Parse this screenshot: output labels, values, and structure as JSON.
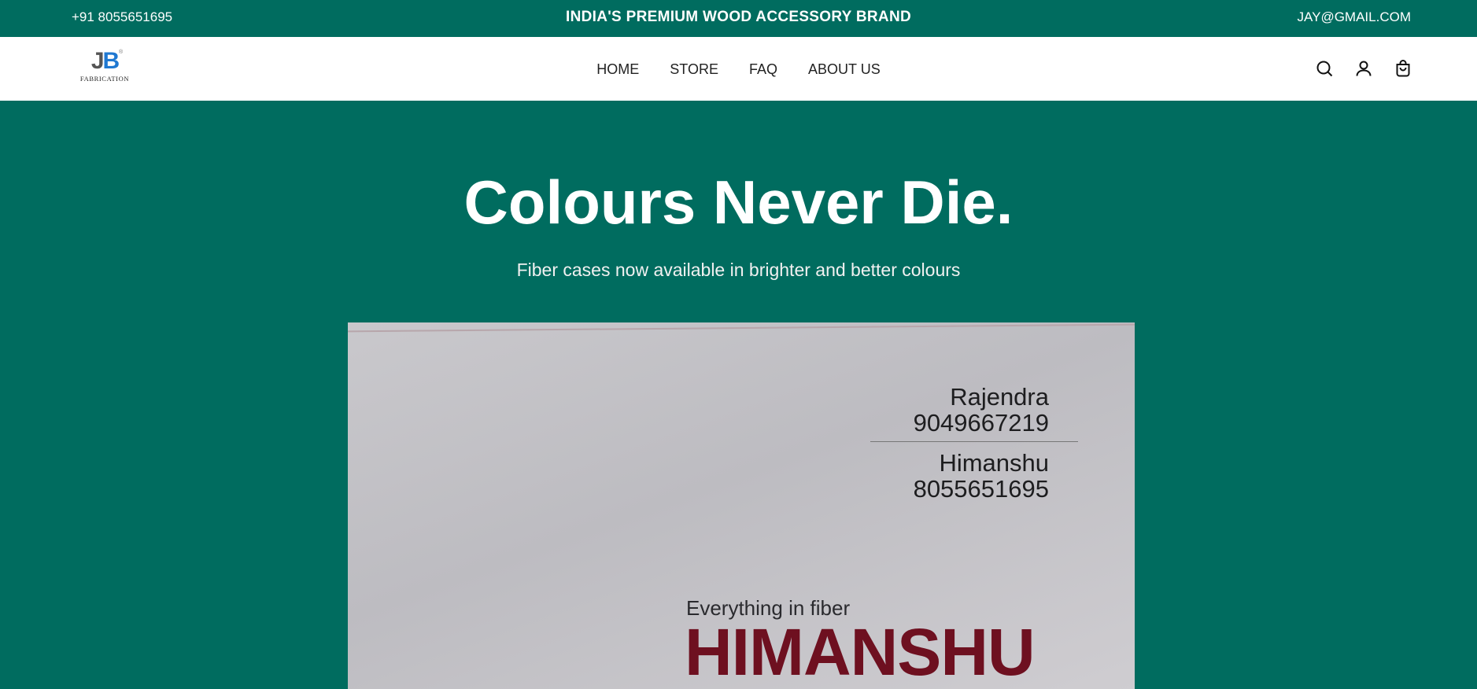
{
  "announcement": {
    "phone": "+91 8055651695",
    "brand_text": "INDIA'S PREMIUM WOOD ACCESSORY BRAND",
    "email": "JAY@GMAIL.COM"
  },
  "header": {
    "logo": {
      "mark_j": "J",
      "mark_b": "B",
      "registered": "®",
      "subtitle": "FABRICATION"
    },
    "nav": [
      {
        "label": "HOME"
      },
      {
        "label": "STORE"
      },
      {
        "label": "FAQ"
      },
      {
        "label": "ABOUT US"
      }
    ],
    "icons": [
      "search-icon",
      "account-icon",
      "cart-icon"
    ]
  },
  "hero": {
    "title": "Colours Never Die.",
    "subtitle": "Fiber cases now available in brighter and better colours",
    "image": {
      "contact_1_name": "Rajendra",
      "contact_1_phone": "9049667219",
      "contact_2_name": "Himanshu",
      "contact_2_phone": "8055651695",
      "tagline": "Everything in fiber",
      "brand_name": "HIMANSHU"
    }
  },
  "colors": {
    "primary": "#006c5f",
    "header_bg": "#ffffff",
    "text_dark": "#222222",
    "logo_blue": "#1f78d1",
    "card_red": "#6e1020"
  }
}
